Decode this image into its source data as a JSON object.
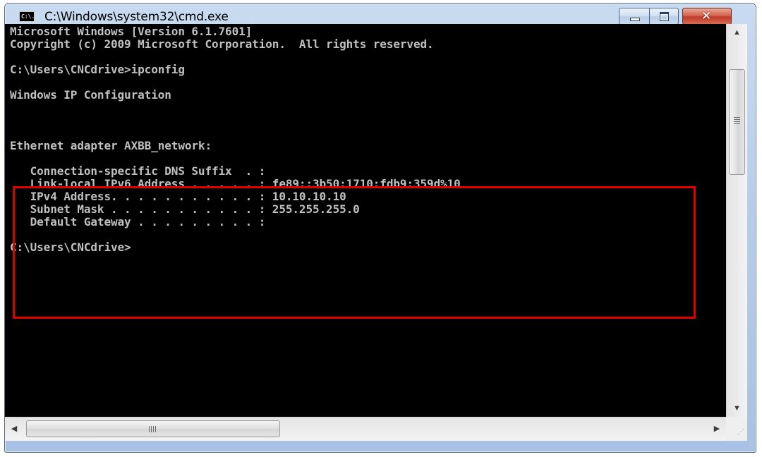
{
  "window": {
    "title": "C:\\Windows\\system32\\cmd.exe",
    "icon_name": "cmd-icon",
    "icon_text": "C:\\.",
    "minimize_icon": "minimize-icon",
    "maximize_icon": "maximize-icon",
    "close_icon": "close-icon",
    "close_glyph": "✕"
  },
  "console": {
    "text_color": "#c0c0c0",
    "background": "#000000",
    "highlight_color": "#e00000",
    "lines": [
      "Microsoft Windows [Version 6.1.7601]",
      "Copyright (c) 2009 Microsoft Corporation.  All rights reserved.",
      "",
      "C:\\Users\\CNCdrive>ipconfig",
      "",
      "Windows IP Configuration",
      "",
      "",
      "",
      "Ethernet adapter AXBB_network:",
      "",
      "   Connection-specific DNS Suffix  . :",
      "   Link-local IPv6 Address . . . . . : fe89::3b50:1710:fdb9:359d%10",
      "   IPv4 Address. . . . . . . . . . . : 10.10.10.10",
      "   Subnet Mask . . . . . . . . . . . : 255.255.255.0",
      "   Default Gateway . . . . . . . . . :",
      "",
      "C:\\Users\\CNCdrive>"
    ]
  },
  "scrollbars": {
    "up_arrow": "▲",
    "down_arrow": "▼",
    "left_arrow": "◀",
    "right_arrow": "▶",
    "thumb_grip_h": "|||",
    "size_grip": "⋰"
  }
}
